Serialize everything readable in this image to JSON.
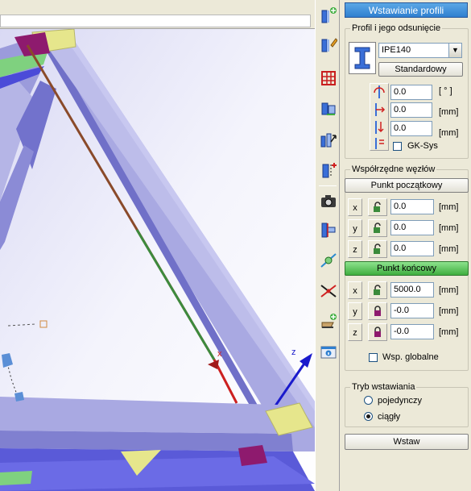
{
  "panel": {
    "title": "Wstawianie profili",
    "profile_group": {
      "label": "Profil i jego odsunięcie",
      "profile": "IPE140",
      "standard_button": "Standardowy",
      "rows": [
        {
          "value": "0.0",
          "unit": "[ ° ]"
        },
        {
          "value": "0.0",
          "unit": "[mm]"
        },
        {
          "value": "0.0",
          "unit": "[mm]"
        }
      ],
      "gk_sys": "GK-Sys"
    },
    "coords_group": {
      "label": "Współrzędne węzłów",
      "start_button": "Punkt początkowy",
      "end_button": "Punkt końcowy",
      "start": [
        {
          "axis": "x",
          "value": "0.0",
          "unit": "[mm]",
          "locked": false
        },
        {
          "axis": "y",
          "value": "0.0",
          "unit": "[mm]",
          "locked": false
        },
        {
          "axis": "z",
          "value": "0.0",
          "unit": "[mm]",
          "locked": false
        }
      ],
      "end": [
        {
          "axis": "x",
          "value": "5000.0",
          "unit": "[mm]",
          "locked": false
        },
        {
          "axis": "y",
          "value": "-0.0",
          "unit": "[mm]",
          "locked": true
        },
        {
          "axis": "z",
          "value": "-0.0",
          "unit": "[mm]",
          "locked": true
        }
      ],
      "global": "Wsp. globalne"
    },
    "mode_group": {
      "label": "Tryb wstawiania",
      "options": [
        "pojedynczy",
        "ciągły"
      ],
      "selected": "ciągły"
    },
    "insert_button": "Wstaw"
  },
  "viewport": {
    "axis_label": "z",
    "marker_label": "x"
  },
  "colors": {
    "beam": "#a6a6dc",
    "beam_dark": "#6767c8",
    "plate": "#e6e68c",
    "node": "#8e1a6e",
    "accent_green": "#3fae3f",
    "title_blue": "#2f7fd0"
  },
  "toolbar": {
    "icons": [
      "insert-profile-icon",
      "edit-profile-icon",
      "grid-icon",
      "connect-profile-icon",
      "extend-profile-icon",
      "split-profile-icon",
      "camera-icon",
      "align-profile-icon",
      "node-icon",
      "intersect-icon",
      "add-plate-icon",
      "info-icon"
    ]
  }
}
